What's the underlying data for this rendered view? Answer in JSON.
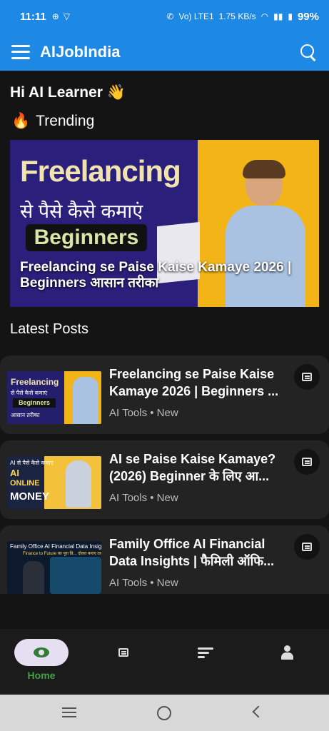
{
  "status": {
    "time": "11:11",
    "network": "Vo) LTE1",
    "speed": "1.75 KB/s",
    "battery": "99%"
  },
  "appbar": {
    "title": "AIJobIndia"
  },
  "home": {
    "greeting": "Hi AI Learner 👋",
    "trending_label": "Trending",
    "trending_emoji": "🔥",
    "hero": {
      "img_title": "Freelancing",
      "img_hindi": "से पैसे कैसे कमाएं",
      "img_pill": "Beginners",
      "caption": "Freelancing se Paise Kaise Kamaye 2026 | Beginners आसान तरीका"
    },
    "latest_label": "Latest Posts",
    "posts": [
      {
        "title": "Freelancing se Paise Kaise Kamaye 2026 | Beginners ...",
        "meta": "AI Tools • New",
        "thumb_a": "Freelancing",
        "thumb_b": "से पैसे कैसे कमाएं",
        "thumb_c": "Beginners",
        "thumb_d": "आसान तरीका"
      },
      {
        "title": "AI se Paise Kaise Kamaye? (2026) Beginner के लिए आ...",
        "meta": "AI Tools • New",
        "thumb_a": "AI से पैसे कैसे कमाए",
        "thumb_b": "AI",
        "thumb_c": "ONLINE",
        "thumb_d": "MONEY"
      },
      {
        "title": "Family Office AI Financial Data Insights | फैमिली ऑफि...",
        "meta": "AI Tools • New",
        "thumb_a": "Family Office AI Financial Data Insights",
        "thumb_b": "Finance to Future का पूरा प्रि... दोलत बनाए ताको"
      }
    ]
  },
  "bottom_nav": {
    "home_label": "Home"
  },
  "colors": {
    "primary": "#1e88e5",
    "background": "#141414",
    "card": "#232323",
    "nav_active": "#43a047"
  }
}
